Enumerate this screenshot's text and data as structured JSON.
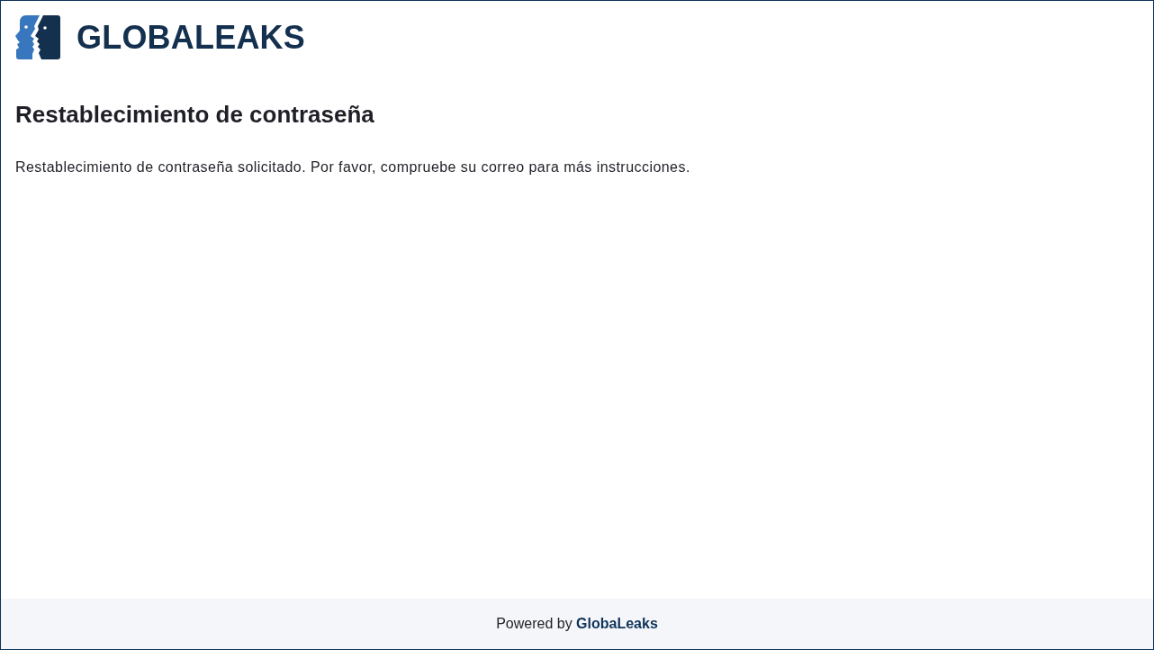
{
  "header": {
    "logo_text": "GLOBALEAKS"
  },
  "page": {
    "title": "Restablecimiento de contraseña",
    "message": "Restablecimiento de contraseña solicitado. Por favor, compruebe su correo para más instrucciones."
  },
  "footer": {
    "text": "Powered by",
    "link": "GlobaLeaks"
  }
}
